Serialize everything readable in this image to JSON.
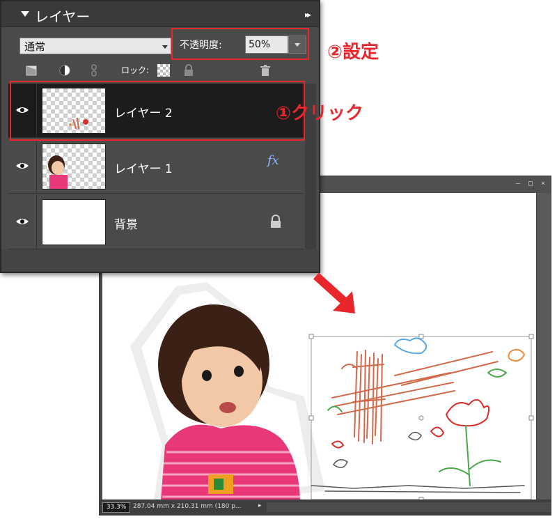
{
  "layers_panel": {
    "title": "レイヤー",
    "blend_mode": "通常",
    "opacity_label": "不透明度:",
    "opacity_value": "50%",
    "lock_label": "ロック:",
    "layers": [
      {
        "name": "レイヤー 2",
        "selected": true,
        "visible": true
      },
      {
        "name": "レイヤー 1",
        "selected": false,
        "visible": true,
        "badge": "fx"
      },
      {
        "name": "背景",
        "selected": false,
        "visible": true,
        "locked": true
      }
    ]
  },
  "document_window": {
    "zoom": "33.3%",
    "doc_size": "287.04 mm x 210.31 mm (180 p..."
  },
  "annotations": {
    "step1": "①クリック",
    "step2": "②設定"
  },
  "colors": {
    "callout": "#e8262b",
    "panel_bg": "#4a4a4a",
    "selected_row": "#1c1c1c"
  }
}
